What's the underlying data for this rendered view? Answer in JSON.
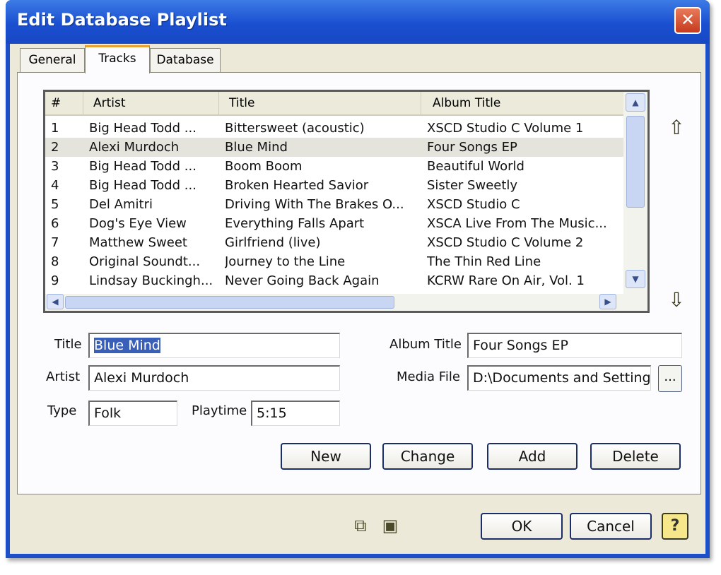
{
  "window": {
    "title": "Edit Database Playlist",
    "close": "✕"
  },
  "tabs": [
    {
      "label": "General"
    },
    {
      "label": "Tracks"
    },
    {
      "label": "Database"
    }
  ],
  "grid": {
    "columns": [
      "#",
      "Artist",
      "Title",
      "Album Title"
    ],
    "rows": [
      {
        "num": "1",
        "artist": "Big Head Todd ...",
        "title": "Bittersweet (acoustic)",
        "album": "XSCD Studio C Volume 1"
      },
      {
        "num": "2",
        "artist": "Alexi Murdoch",
        "title": "Blue Mind",
        "album": "Four Songs EP"
      },
      {
        "num": "3",
        "artist": "Big Head Todd ...",
        "title": "Boom Boom",
        "album": "Beautiful World"
      },
      {
        "num": "4",
        "artist": "Big Head Todd ...",
        "title": "Broken Hearted Savior",
        "album": "Sister Sweetly"
      },
      {
        "num": "5",
        "artist": "Del Amitri",
        "title": "Driving With The Brakes O...",
        "album": "XSCD Studio C"
      },
      {
        "num": "6",
        "artist": "Dog's Eye View",
        "title": "Everything Falls Apart",
        "album": "XSCA Live From The Music..."
      },
      {
        "num": "7",
        "artist": "Matthew Sweet",
        "title": "Girlfriend (live)",
        "album": "XSCD Studio C Volume 2"
      },
      {
        "num": "8",
        "artist": "Original Soundt...",
        "title": "Journey to the Line",
        "album": "The Thin Red Line"
      },
      {
        "num": "9",
        "artist": "Lindsay Buckingh...",
        "title": "Never Going Back Again",
        "album": "KCRW Rare On Air, Vol. 1"
      }
    ],
    "selected_row": 2
  },
  "form": {
    "title_label": "Title",
    "title_value": "Blue Mind",
    "artist_label": "Artist",
    "artist_value": "Alexi Murdoch",
    "type_label": "Type",
    "type_value": "Folk",
    "playtime_label": "Playtime",
    "playtime_value": "5:15",
    "album_label": "Album Title",
    "album_value": "Four Songs EP",
    "media_label": "Media File",
    "media_value": "D:\\Documents and Settings",
    "browse_label": "..."
  },
  "actions": {
    "new": "New",
    "change": "Change",
    "add": "Add",
    "delete": "Delete"
  },
  "footer": {
    "ok": "OK",
    "cancel": "Cancel",
    "help": "?"
  },
  "icons": {
    "close": "close-icon",
    "move_up": "arrow-up-icon",
    "move_down": "arrow-down-icon",
    "copy": "copy-icon",
    "paste": "paste-icon",
    "help": "help-icon"
  }
}
